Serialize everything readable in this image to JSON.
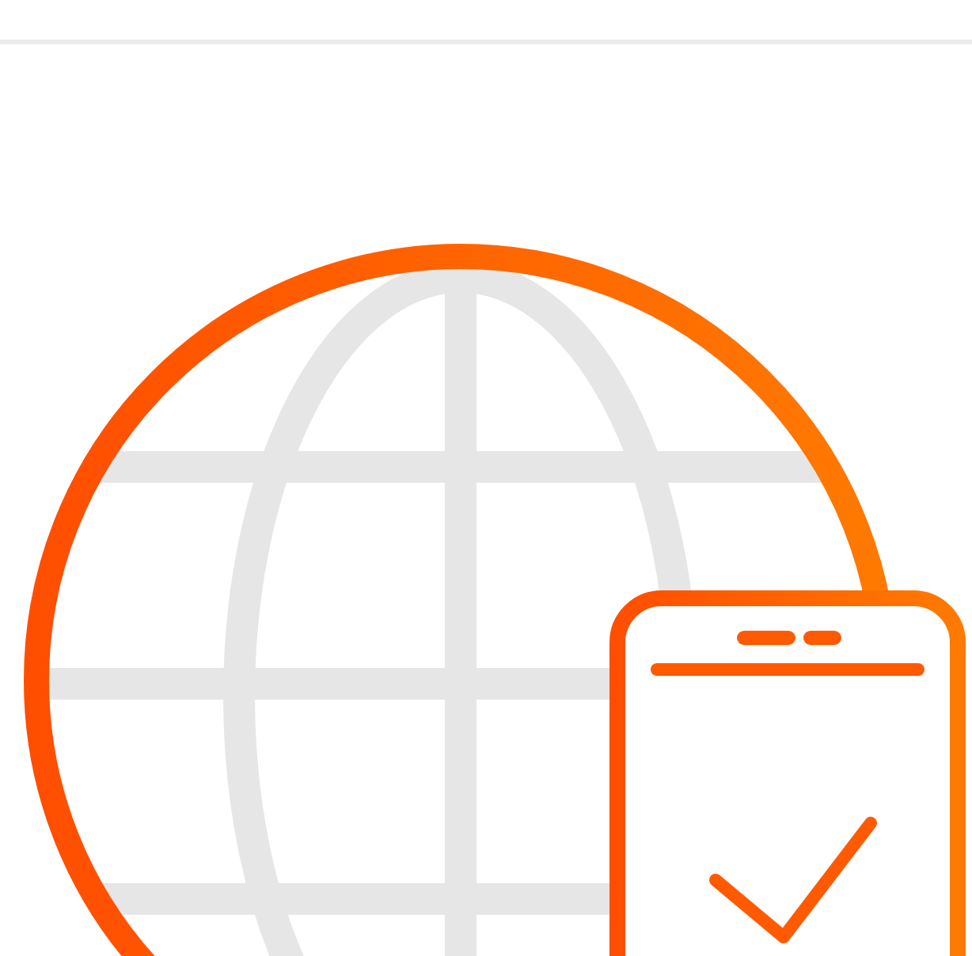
{
  "illustration": {
    "kind": "globe-with-phone"
  }
}
